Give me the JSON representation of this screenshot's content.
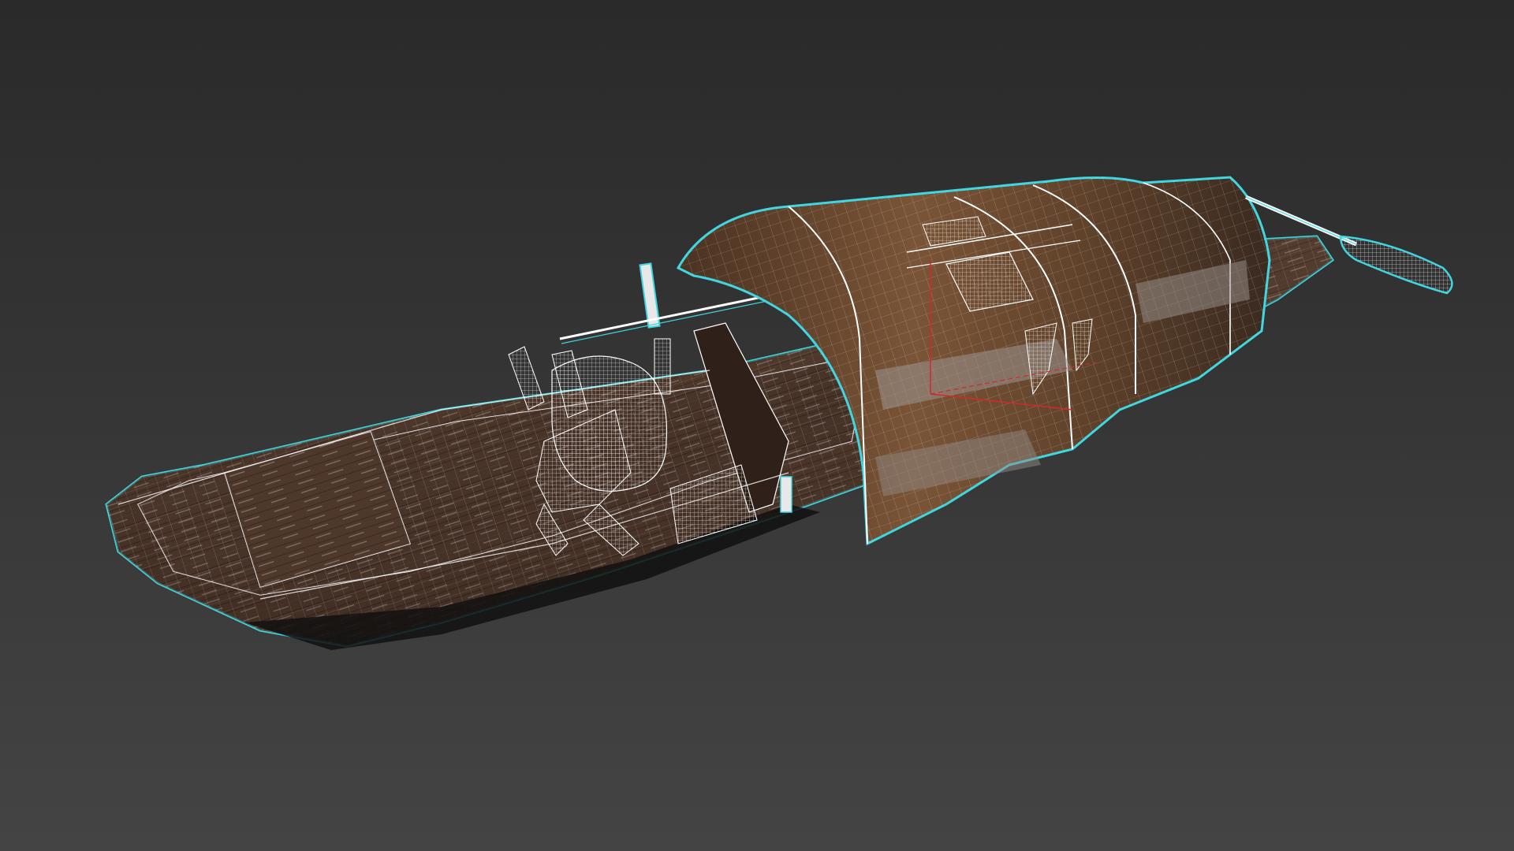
{
  "viewport": {
    "background_top": "#2a2a2a",
    "background_bottom": "#444444"
  },
  "model": {
    "name": "wooden-boat-with-canopy",
    "display_mode": "textured-with-wireframe",
    "selection_outline_color": "#3fd6e0",
    "wireframe_color": "#ffffff",
    "wood_dark": "#3a2a22",
    "wood_mid": "#5b4032",
    "wood_light": "#8a6a55",
    "canopy_wood": "#6b4a30",
    "gizmo_color": "#d22a2a"
  }
}
